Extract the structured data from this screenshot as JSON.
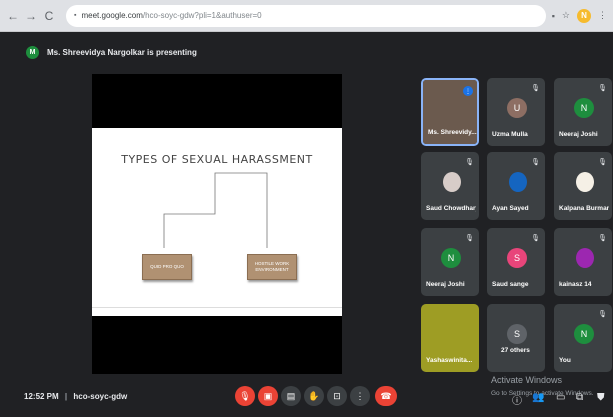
{
  "browser": {
    "url_host": "meet.google.com",
    "url_path": "/hco-soyc-gdw?pli=1&authuser=0",
    "profile_initial": "N"
  },
  "banner": {
    "badge": "M",
    "text": "Ms. Shreevidya Nargolkar is presenting"
  },
  "slide": {
    "title": "TYPES OF SEXUAL HARASSMENT",
    "box_left": "QUID PRO QUO",
    "box_right": "HOSTILE WORK ENVIRONMENT"
  },
  "participants": [
    {
      "name": "Ms. Shreevidy...",
      "kind": "photo",
      "color": "#6b5a4e",
      "speaking": true
    },
    {
      "name": "Uzma Mulla",
      "kind": "initial",
      "initial": "U",
      "color": "#8d6e63"
    },
    {
      "name": "Neeraj Joshi",
      "kind": "initial",
      "initial": "N",
      "color": "#1e8e3e"
    },
    {
      "name": "Saud Chowdhary",
      "kind": "photo",
      "color": "#d7ccc8"
    },
    {
      "name": "Ayan Sayed",
      "kind": "photo",
      "color": "#1565c0"
    },
    {
      "name": "Kalpana Burman",
      "kind": "photo",
      "color": "#f5f0e6"
    },
    {
      "name": "Neeraj Joshi",
      "kind": "initial",
      "initial": "N",
      "color": "#1e8e3e"
    },
    {
      "name": "Saud sange",
      "kind": "initial",
      "initial": "S",
      "color": "#e8457a"
    },
    {
      "name": "kainasz 14",
      "kind": "photo",
      "color": "#9c27b0"
    },
    {
      "name": "Yashaswinita...",
      "kind": "photo",
      "color": "#9e9d24"
    },
    {
      "name": "27 others",
      "kind": "others",
      "initial": "S",
      "color": "#5f6368"
    },
    {
      "name": "You",
      "kind": "initial",
      "initial": "N",
      "color": "#1e8e3e"
    }
  ],
  "footer": {
    "time": "12:52 PM",
    "separator": "|",
    "meeting_code": "hco-soyc-gdw",
    "activate_title": "Activate Windows",
    "activate_sub": "Go to Settings to activate Windows."
  },
  "icons": {
    "back": "←",
    "forward": "→",
    "reload": "C",
    "lock": "🔒",
    "mic_off": "🎙",
    "cam_off": "▣",
    "captions": "▤",
    "hand": "✋",
    "present": "⊡",
    "more": "⋮",
    "end_call": "☎",
    "info": "ⓘ",
    "people": "👥",
    "chat": "▭",
    "activities": "⧉",
    "shield": "⛊",
    "mute": "🎙",
    "cast": "▪",
    "star": "☆",
    "menu": "⋮"
  }
}
